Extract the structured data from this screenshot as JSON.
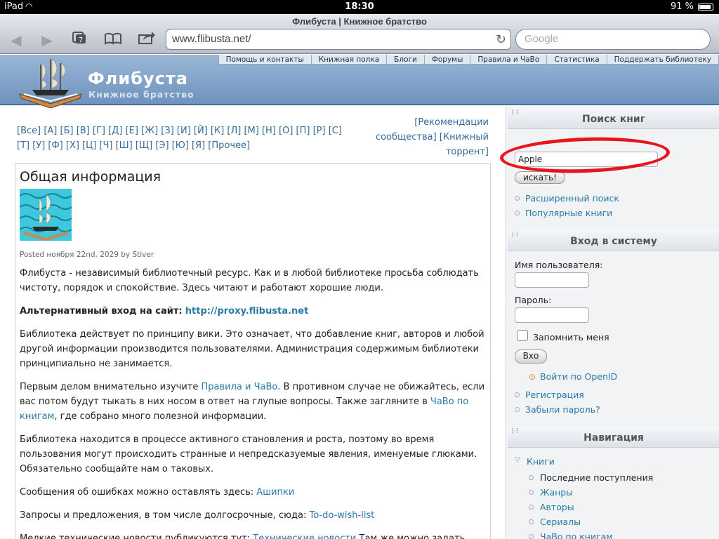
{
  "status": {
    "carrier": "iPad",
    "time": "18:30",
    "battery": "91 %",
    "battery_level": 0.91
  },
  "browser": {
    "title": "Флибуста | Книжное братство",
    "url": "www.flibusta.net/",
    "search_placeholder": "Google"
  },
  "site": {
    "name": "Флибуста",
    "slogan": "Книжное братство",
    "top_menu": [
      "Помощь и контакты",
      "Книжная полка",
      "Блоги",
      "Форумы",
      "Правила и ЧаВо",
      "Статистика",
      "Поддержать библиотеку"
    ]
  },
  "alphabet": "[Все] [А] [Б] [В] [Г] [Д] [Е] [Ж] [З] [И] [Й] [К] [Л] [М] [Н] [О] [П] [Р] [С] [Т] [У] [Ф] [Х] [Ц] [Ч] [Ш] [Щ] [Э] [Ю] [Я] [Прочее]",
  "recommend": "[Рекомендации сообщества] [Книжный торрент]",
  "article": {
    "title": "Общая информация",
    "posted": "Posted ноября 22nd, 2029 by Stiver",
    "p1": "Флибуста - независимый библиотечный ресурс. Как и в любой библиотеке просьба соблюдать чистоту, порядок и спокойствие. Здесь читают и работают хорошие люди.",
    "alt_label": "Альтернативный вход на сайт:",
    "alt_link": "http://proxy.flibusta.net",
    "p2": "Библиотека действует по принципу вики. Это означает, что добавление книг, авторов и любой другой информации производится пользователями. Администрация содержимым библиотеки принципиально не занимается.",
    "p3a": "Первым делом внимательно изучите",
    "p3_link1": "Правила и ЧаВо",
    "p3b": ". В противном случае не обижайтесь, если вас потом будут тыкать в них носом в ответ на глупые вопросы. Также загляните в",
    "p3_link2": "ЧаВо по книгам",
    "p3c": ", где собрано много полезной информации.",
    "p4": "Библиотека находится в процессе активного становления и роста, поэтому во время пользования могут происходить странные и непредсказуемые явления, именуемые глюками. Обязательно сообщайте нам о таковых.",
    "p5": "Сообщения об ошибках можно оставлять здесь:",
    "p5_link": "Ашипки",
    "p6": "Запросы и предложения, в том числе долгосрочные, сюда:",
    "p6_link": "To-do-wish-list",
    "p7": "Мелкие технические новости публикуются тут:",
    "p7_link": "Технические новости",
    "p7b": "Там же можно задать"
  },
  "sidebar": {
    "collapse": "[-]",
    "search": {
      "title": "Поиск книг",
      "value": "Apple",
      "button": "искать!",
      "advanced": "Расширенный поиск",
      "popular": "Популярные книги"
    },
    "login": {
      "title": "Вход в систему",
      "username_label": "Имя пользователя:",
      "password_label": "Пароль:",
      "remember": "Запомнить меня",
      "button": "Вхо",
      "openid": "Войти по OpenID",
      "register": "Регистрация",
      "forgot": "Забыли пароль?"
    },
    "nav": {
      "title": "Навигация",
      "books": "Книги",
      "items": [
        "Последние поступления",
        "Жанры",
        "Авторы",
        "Сериалы",
        "ЧаВо по книгам"
      ]
    }
  }
}
